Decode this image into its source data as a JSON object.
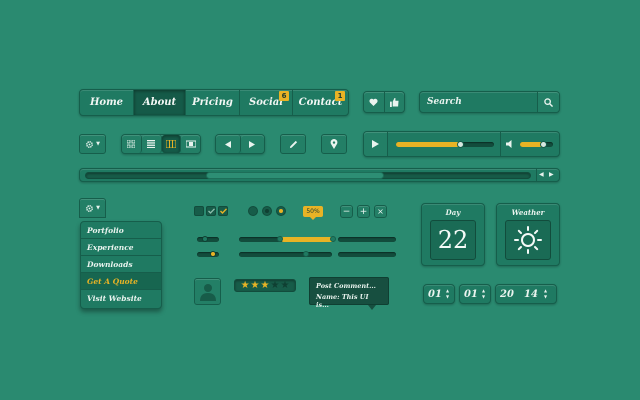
{
  "nav": {
    "items": [
      {
        "label": "Home",
        "active": false,
        "badge": ""
      },
      {
        "label": "About",
        "active": true,
        "badge": ""
      },
      {
        "label": "Pricing",
        "active": false,
        "badge": ""
      },
      {
        "label": "Social",
        "active": false,
        "badge": "6"
      },
      {
        "label": "Contact",
        "active": false,
        "badge": "1"
      }
    ]
  },
  "search": {
    "placeholder": "Search",
    "icon": "search-icon"
  },
  "icons": {
    "heart": "heart-icon",
    "like": "thumbs-up-icon",
    "gear": "gear-icon",
    "grid": "grid-view-icon",
    "list": "list-view-icon",
    "columns": "columns-view-icon",
    "film": "film-view-icon",
    "prev": "prev-arrow-icon",
    "next": "next-arrow-icon",
    "pencil": "pencil-icon",
    "pin": "map-pin-icon",
    "play": "play-icon",
    "volume": "volume-icon",
    "user": "user-avatar-icon",
    "sun": "sun-icon"
  },
  "media": {
    "progress": 0.65,
    "volume": 0.7
  },
  "scrollbar": {
    "position": 0.45
  },
  "dropdown": {
    "items": [
      "Portfolio",
      "Experience",
      "Downloads",
      "Get A Quote",
      "Visit Website"
    ],
    "highlighted": "Get A Quote"
  },
  "percent_tooltip": "50%",
  "rating": {
    "value": 3,
    "max": 5
  },
  "comment": {
    "line1": "Post Comment...",
    "line2": "Name: This UI is..."
  },
  "day_widget": {
    "title": "Day",
    "value": "22"
  },
  "weather_widget": {
    "title": "Weather"
  },
  "date_picker": {
    "fields": [
      "01",
      "01",
      "20",
      "14"
    ]
  },
  "colors": {
    "background": "#2a8a70",
    "accent": "#e8b325",
    "dark": "#175c49"
  }
}
